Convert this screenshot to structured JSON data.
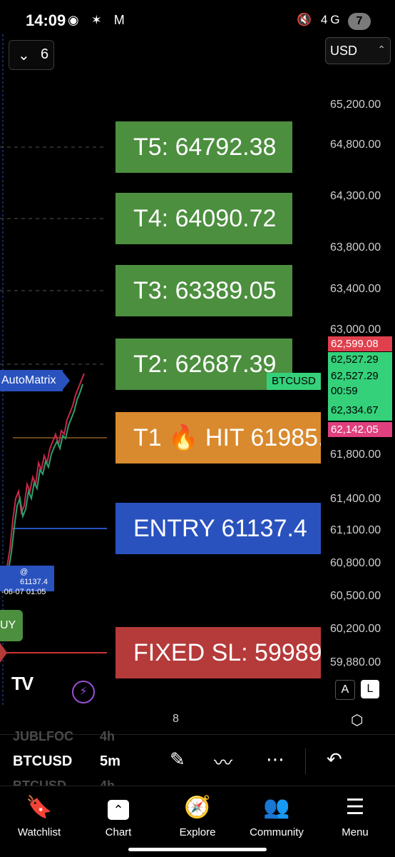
{
  "status_bar": {
    "time": "14:09",
    "left_icons": "◉ ✶ M",
    "right_icons": "🔇 4G ıl",
    "notification_count": "7"
  },
  "chart": {
    "interval_menu": "6",
    "currency": "USD",
    "axis_ticks": [
      "65,200.00",
      "64,800.00",
      "64,300.00",
      "63,800.00",
      "63,400.00",
      "63,000.00",
      "61,800.00",
      "61,400.00",
      "61,100.00",
      "60,800.00",
      "60,500.00",
      "60,200.00",
      "59,880.00"
    ],
    "price_tags": {
      "red_top": "62,599.08",
      "green1": "62,527.29",
      "green2": "62,527.29",
      "countdown": "00:59",
      "green3": "62,334.67",
      "pink": "62,142.05"
    },
    "symbol_badge": "BTCUSD",
    "indicator_tag": "AutoMatrix",
    "entry_info_price": "@ 61137.4",
    "entry_info_date": "-06-07 01:05",
    "buy_tag": "UY",
    "labels": {
      "t5": "T5: 64792.38",
      "t4": "T4: 64090.72",
      "t3": "T3: 63389.05",
      "t2": "T2: 62687.39",
      "t1": "T1 🔥 HIT 61985.",
      "entry": "ENTRY 61137.4",
      "sl": "FIXED SL: 59989."
    },
    "x_tick": "8",
    "scale_a": "A",
    "scale_l": "L",
    "logo": "TV"
  },
  "watchlist_rows": [
    {
      "symbol": "JUBLFOC",
      "interval": "4h"
    },
    {
      "symbol": "BTCUSD",
      "interval": "5m"
    },
    {
      "symbol": "BTCUSD",
      "interval": "4h"
    }
  ],
  "nav": [
    {
      "label": "Watchlist",
      "icon": "bookmark-icon"
    },
    {
      "label": "Chart",
      "icon": "chart-icon"
    },
    {
      "label": "Explore",
      "icon": "compass-icon"
    },
    {
      "label": "Community",
      "icon": "people-icon"
    },
    {
      "label": "Menu",
      "icon": "menu-icon"
    }
  ],
  "colors": {
    "green": "#4c8f3f",
    "orange": "#d98a2e",
    "blue": "#2a52be",
    "red": "#b53a3a"
  }
}
